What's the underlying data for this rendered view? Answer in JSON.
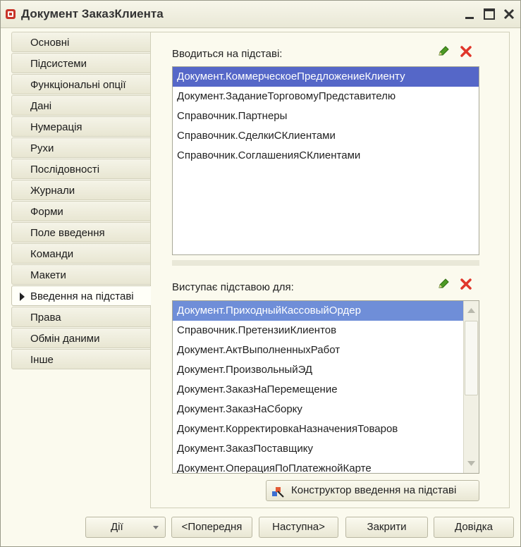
{
  "window": {
    "title": "Документ ЗаказКлиента"
  },
  "tabs": [
    "Основні",
    "Підсистеми",
    "Функціональні опції",
    "Дані",
    "Нумерація",
    "Рухи",
    "Послідовності",
    "Журнали",
    "Форми",
    "Поле введення",
    "Команди",
    "Макети",
    "Введення на підставі",
    "Права",
    "Обмін даними",
    "Інше"
  ],
  "active_tab_index": 12,
  "based_on": {
    "label": "Вводиться на підставі:",
    "items": [
      "Документ.КоммерческоеПредложениеКлиенту",
      "Документ.ЗаданиеТорговомуПредставителю",
      "Справочник.Партнеры",
      "Справочник.СделкиСКлиентами",
      "Справочник.СоглашенияСКлиентами"
    ]
  },
  "basis_for": {
    "label": "Виступає підставою для:",
    "items": [
      "Документ.ПриходныйКассовыйОрдер",
      "Справочник.ПретензииКлиентов",
      "Документ.АктВыполненныхРабот",
      "Документ.ПроизвольныйЭД",
      "Документ.ЗаказНаПеремещение",
      "Документ.ЗаказНаСборку",
      "Документ.КорректировкаНазначенияТоваров",
      "Документ.ЗаказПоставщику",
      "Документ.ОперацияПоПлатежнойКарте"
    ]
  },
  "constructor_button": "Конструктор введення на підставі",
  "footer": {
    "actions": "Дії",
    "prev": "<Попередня",
    "next": "Наступна>",
    "close": "Закрити",
    "help": "Довідка"
  },
  "colors": {
    "selection": "#5567c8",
    "selection_secondary": "#6f8ed8",
    "edit_icon": "#3f8f1f",
    "delete_icon": "#e0362a"
  }
}
